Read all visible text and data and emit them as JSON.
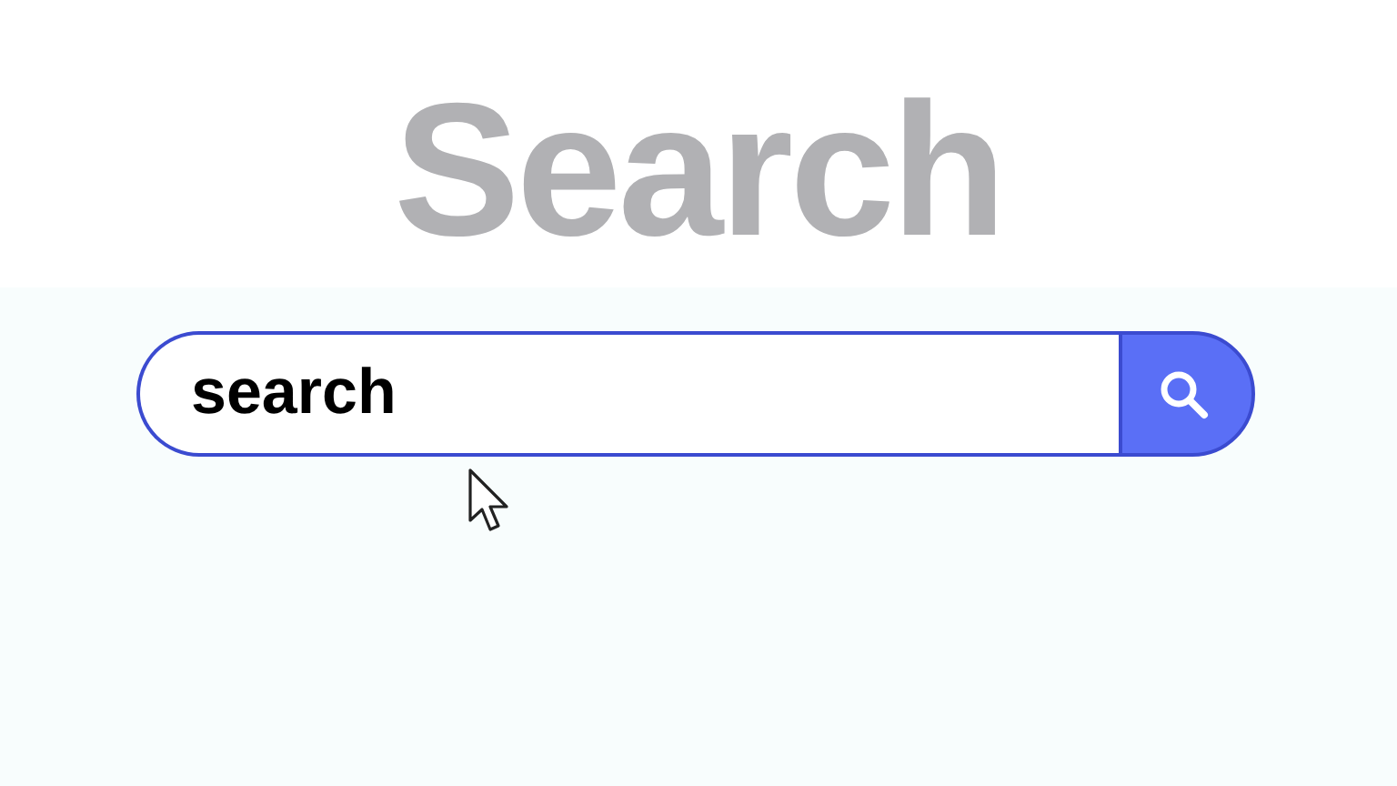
{
  "title": "Search",
  "search": {
    "value": "search"
  }
}
